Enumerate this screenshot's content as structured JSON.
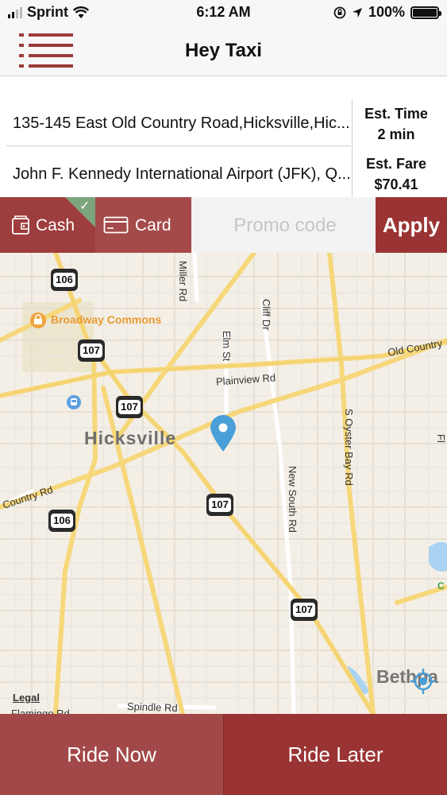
{
  "status_bar": {
    "carrier": "Sprint",
    "time": "6:12 AM",
    "battery": "100%",
    "icons": [
      "signal-icon",
      "wifi-icon",
      "orientation-lock-icon",
      "location-arrow-icon",
      "battery-icon"
    ]
  },
  "header": {
    "title": "Hey Taxi",
    "menu_icon": "hamburger-menu-icon"
  },
  "trip": {
    "pickup": "135-145 East Old Country Road,Hicksville,Hic...",
    "dropoff": "John F. Kennedy International Airport (JFK), Q...",
    "est_time_label": "Est. Time",
    "est_time_value": "2 min",
    "est_fare_label": "Est. Fare",
    "est_fare_value": "$70.41"
  },
  "payment": {
    "cash_label": "Cash",
    "card_label": "Card",
    "selected": "Cash",
    "promo_placeholder": "Promo code",
    "apply_label": "Apply"
  },
  "map": {
    "place": "Hicksville",
    "poi": "Broadway Commons",
    "partial_place": "Bethpa",
    "partial_c": "C",
    "roads": {
      "miller": "Miller Rd",
      "cliff": "Cliff Dr",
      "elm": "Elm St",
      "plainview": "Plainview Rd",
      "old_country_right": "Old Country",
      "old_country_left": "Country Rd",
      "s_oyster_bay": "S Oyster Bay Rd",
      "new_south": "New South Rd",
      "spindle": "Spindle Rd",
      "flamingo": "Flamingo Rd",
      "fl": "Fl"
    },
    "shields": {
      "s1": "106",
      "s2": "107",
      "s3": "107",
      "s4": "107",
      "s5": "106",
      "s6": "107"
    },
    "legal": "Legal",
    "accent_color": "#4a9fd8"
  },
  "actions": {
    "ride_now": "Ride Now",
    "ride_later": "Ride Later"
  },
  "colors": {
    "brand": "#9a3434",
    "brand_light": "#a24848",
    "check_green": "#7da57b"
  }
}
